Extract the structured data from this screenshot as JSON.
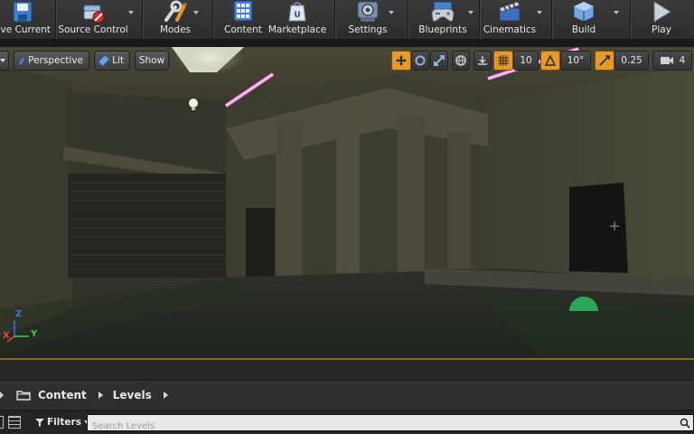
{
  "toolbar": {
    "save_label": "ave Current",
    "source_control_label": "Source Control",
    "modes_label": "Modes",
    "content_label": "Content",
    "marketplace_label": "Marketplace",
    "settings_label": "Settings",
    "blueprints_label": "Blueprints",
    "cinematics_label": "Cinematics",
    "build_label": "Build",
    "play_label": "Play"
  },
  "viewport": {
    "perspective_label": "Perspective",
    "lit_label": "Lit",
    "show_label": "Show",
    "grid_snap_value": "10",
    "rotation_snap_value": "10°",
    "scale_snap_value": "0.25",
    "camera_speed_value": "4",
    "axis": {
      "z": "Z",
      "x": "X",
      "y": "Y"
    }
  },
  "content_browser": {
    "breadcrumb": [
      "Content",
      "Levels"
    ],
    "filters_label": "Filters",
    "search_placeholder": "Search Levels"
  },
  "colors": {
    "accent_orange": "#e39a2a",
    "neon_pink": "#ff7fe6",
    "toolbar_bg": "#2c2c2c"
  }
}
